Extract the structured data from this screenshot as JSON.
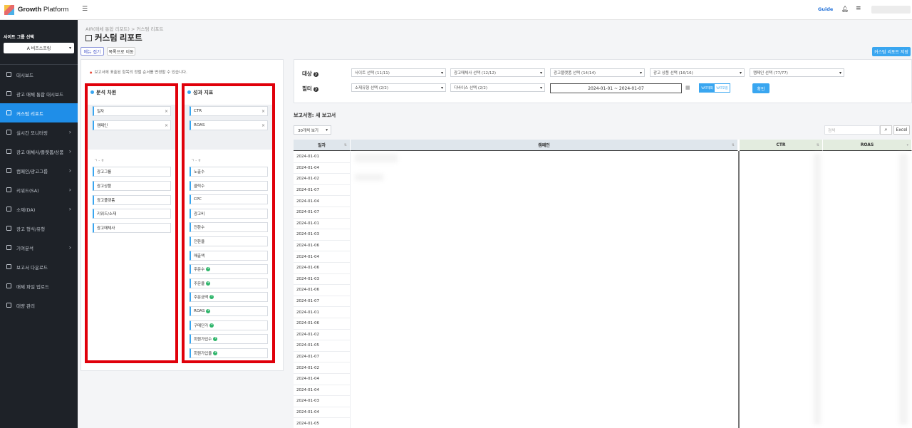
{
  "app": {
    "brand_bold": "Growth",
    "brand_rest": " Platform"
  },
  "sidebar": {
    "site_group_title": "사이트 그룹 선택",
    "site_group_value": "A 비즈스프링",
    "items": [
      {
        "label": "대시보드",
        "has_children": false,
        "active": false
      },
      {
        "label": "광고 매체 통합 대시보드",
        "has_children": false,
        "active": false
      },
      {
        "label": "커스텀 리포트",
        "has_children": false,
        "active": true
      },
      {
        "label": "실시간 모니터링",
        "has_children": true,
        "active": false
      },
      {
        "label": "광고 매체사/플랫폼/상품",
        "has_children": true,
        "active": false
      },
      {
        "label": "캠페인/광고그룹",
        "has_children": true,
        "active": false
      },
      {
        "label": "키워드(SA)",
        "has_children": true,
        "active": false
      },
      {
        "label": "소재(DA)",
        "has_children": true,
        "active": false
      },
      {
        "label": "광고 형식/유형",
        "has_children": false,
        "active": false
      },
      {
        "label": "기여분석",
        "has_children": true,
        "active": false
      },
      {
        "label": "보고서 다운로드",
        "has_children": false,
        "active": false
      },
      {
        "label": "매체 파일 업로드",
        "has_children": false,
        "active": false
      },
      {
        "label": "대량 관리",
        "has_children": false,
        "active": false
      }
    ]
  },
  "topbar": {
    "guide": "Guide",
    "bell_icon": "bell-icon",
    "menu_icon": "grid-menu-icon"
  },
  "header": {
    "breadcrumb": "AIR(매체 통합 리포트)  >  커스텀 리포트",
    "title": "커스텀 리포트",
    "menu_collapse_btn": "메뉴 접기",
    "to_list_btn": "목록으로 이동",
    "save_btn": "커스텀 리포트 저장"
  },
  "builder": {
    "note": "보고서에 표출된 항목의 정렬 순서를 변경할 수 있습니다.",
    "dimensions": {
      "title": "분석 차원",
      "selected": [
        "일자",
        "캠페인"
      ],
      "sort_label": "ㄱ - ㅎ",
      "available": [
        "광고그룹",
        "광고상품",
        "광고플랫폼",
        "키워드/소재",
        "광고매체사"
      ]
    },
    "metrics": {
      "title": "성과 지표",
      "selected": [
        "CTR",
        "ROAS"
      ],
      "sort_label": "ㄱ - ㅎ",
      "available": [
        {
          "label": "노출수",
          "badge": false
        },
        {
          "label": "클릭수",
          "badge": false
        },
        {
          "label": "CPC",
          "badge": false
        },
        {
          "label": "광고비",
          "badge": false
        },
        {
          "label": "전환수",
          "badge": false
        },
        {
          "label": "전환율",
          "badge": false
        },
        {
          "label": "매출액",
          "badge": false
        },
        {
          "label": "주문수",
          "badge": true
        },
        {
          "label": "주문율",
          "badge": true
        },
        {
          "label": "주문금액",
          "badge": true
        },
        {
          "label": "ROAS",
          "badge": true
        },
        {
          "label": "구매단가",
          "badge": true
        },
        {
          "label": "회원가입수",
          "badge": true
        },
        {
          "label": "회원가입율",
          "badge": true
        }
      ]
    }
  },
  "filters": {
    "target_label": "대상",
    "filter_label": "필터",
    "target": [
      "사이트 선택 (11/11)",
      "광고매체사 선택 (12/12)",
      "광고플랫폼 선택 (14/14)",
      "광고 상품 선택 (16/16)",
      "캠페인 선택 (77/77)"
    ],
    "filter": [
      "소재유형 선택 (2/2)",
      "디바이스 선택 (2/2)"
    ],
    "date_range": "2024-01-01 ~ 2024-01-07",
    "vat_excl": "VAT제외",
    "vat_incl": "VAT포함",
    "confirm": "확인"
  },
  "report": {
    "name": "보고서명: 새 보고서",
    "per_page": "30개씩 보기",
    "search_placeholder": "검색",
    "excel": "Excel",
    "columns": [
      "일자",
      "캠페인",
      "CTR",
      "ROAS"
    ],
    "dates": [
      "2024-01-01",
      "2024-01-04",
      "2024-01-02",
      "2024-01-07",
      "2024-01-04",
      "2024-01-07",
      "2024-01-01",
      "2024-01-03",
      "2024-01-06",
      "2024-01-04",
      "2024-01-06",
      "2024-01-03",
      "2024-01-06",
      "2024-01-07",
      "2024-01-01",
      "2024-01-06",
      "2024-01-02",
      "2024-01-05",
      "2024-01-07",
      "2024-01-02",
      "2024-01-04",
      "2024-01-04",
      "2024-01-03",
      "2024-01-04",
      "2024-01-05"
    ]
  }
}
